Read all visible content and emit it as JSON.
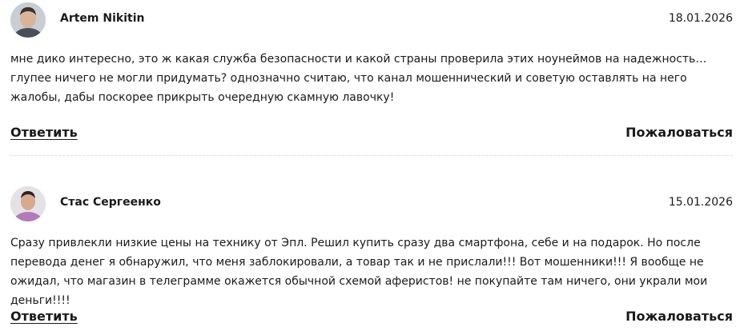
{
  "comments": [
    {
      "author": "Artem Nikitin",
      "avatar_icon": "user-photo-avatar",
      "date": "18.01.2026",
      "text": "мне дико интересно, это ж какая служба безопасности и какой страны проверила этих ноунеймов на надежность… глупее ничего не могли придумать? однозначно считаю, что канал мошеннический и советую оставлять на него жалобы, дабы поскорее прикрыть очередную скамную лавочку!",
      "reply_label": "Ответить",
      "complain_label": "Пожаловаться"
    },
    {
      "author": "Стас Сергеенко",
      "avatar_icon": "user-photo-avatar",
      "date": "15.01.2026",
      "text": "Сразу привлекли низкие цены на технику от Эпл. Решил купить сразу два смартфона, себе и на подарок. Но после перевода денег я обнаружил, что меня заблокировали, а товар так и не прислали!!! Вот мошенники!!! Я вообще не ожидал, что магазин в телеграмме окажется обычной схемой аферистов! не покупайте там ничего, они украли мои деньги!!!!",
      "reply_label": "Ответить",
      "complain_label": "Пожаловаться"
    }
  ]
}
